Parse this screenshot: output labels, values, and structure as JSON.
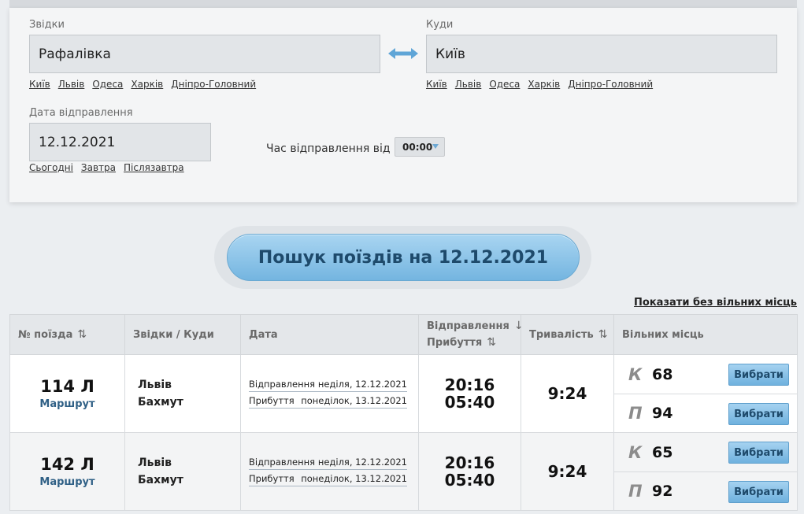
{
  "form": {
    "from_label": "Звідки",
    "from_value": "Рафалівка",
    "to_label": "Куди",
    "to_value": "Київ",
    "quick_from": [
      "Київ",
      "Львів",
      "Одеса",
      "Харків",
      "Дніпро-Головний"
    ],
    "quick_to": [
      "Київ",
      "Львів",
      "Одеса",
      "Харків",
      "Дніпро-Головний"
    ],
    "date_label": "Дата відправлення",
    "date_value": "12.12.2021",
    "quick_dates": [
      "Сьогодні",
      "Завтра",
      "Післязавтра"
    ],
    "time_label": "Час відправлення від",
    "time_value": "00:00"
  },
  "search_button": "Пошук поїздів на 12.12.2021",
  "show_all_link": "Показати без вільних місць",
  "table": {
    "headers": {
      "train": "№ поїзда",
      "route": "Звідки / Куди",
      "date": "Дата",
      "departure": "Відправлення",
      "arrival": "Прибуття",
      "duration": "Тривалість",
      "seats": "Вільних місць"
    },
    "rows": [
      {
        "train_number": "114 Л",
        "route_link": "Маршрут",
        "from": "Львів",
        "to": "Бахмут",
        "dep_label": "Відправлення",
        "dep_date": "неділя, 12.12.2021",
        "arr_label": "Прибуття",
        "arr_date": "понеділок, 13.12.2021",
        "dep_time": "20:16",
        "arr_time": "05:40",
        "duration": "9:24",
        "seats": [
          {
            "type": "К",
            "count": "68",
            "button": "Вибрати"
          },
          {
            "type": "П",
            "count": "94",
            "button": "Вибрати"
          }
        ]
      },
      {
        "train_number": "142 Л",
        "route_link": "Маршрут",
        "from": "Львів",
        "to": "Бахмут",
        "dep_label": "Відправлення",
        "dep_date": "неділя, 12.12.2021",
        "arr_label": "Прибуття",
        "arr_date": "понеділок, 13.12.2021",
        "dep_time": "20:16",
        "arr_time": "05:40",
        "duration": "9:24",
        "seats": [
          {
            "type": "К",
            "count": "65",
            "button": "Вибрати"
          },
          {
            "type": "П",
            "count": "92",
            "button": "Вибрати"
          }
        ]
      }
    ]
  },
  "colors": {
    "accent": "#74b5e0",
    "accent_text": "#1e4a6b",
    "route_link": "#2e5f85",
    "swap_icon": "#5fa5d7"
  }
}
